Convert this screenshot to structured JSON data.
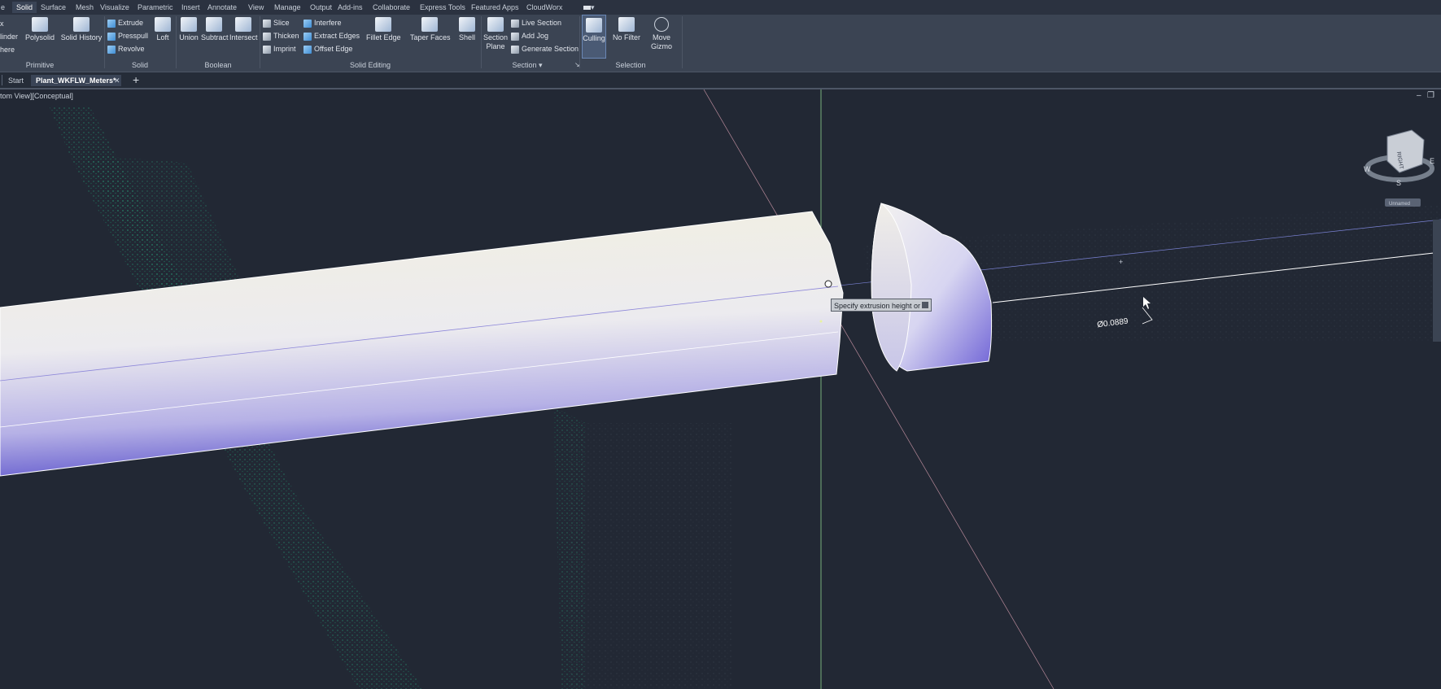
{
  "menu_tabs": [
    {
      "label": "Solid",
      "active": true
    },
    {
      "label": "Surface"
    },
    {
      "label": "Mesh"
    },
    {
      "label": "Visualize"
    },
    {
      "label": "Parametric"
    },
    {
      "label": "Insert"
    },
    {
      "label": "Annotate"
    },
    {
      "label": "View"
    },
    {
      "label": "Manage"
    },
    {
      "label": "Output"
    },
    {
      "label": "Add-ins"
    },
    {
      "label": "Collaborate"
    },
    {
      "label": "Express Tools"
    },
    {
      "label": "Featured Apps"
    },
    {
      "label": "CloudWorx"
    }
  ],
  "ribbon": {
    "primitive": {
      "title": "Primitive",
      "box_fragment": "x",
      "cylinder_fragment": "linder",
      "sphere_fragment": "here",
      "polysolid": "Polysolid"
    },
    "solid": {
      "title": "Solid",
      "solid_history": "Solid History",
      "extrude": "Extrude",
      "presspull": "Presspull",
      "revolve": "Revolve",
      "loft": "Loft"
    },
    "boolean": {
      "title": "Boolean",
      "union": "Union",
      "subtract": "Subtract",
      "intersect": "Intersect"
    },
    "solid_editing": {
      "title": "Solid Editing",
      "slice": "Slice",
      "thicken": "Thicken",
      "imprint": "Imprint",
      "interfere": "Interfere",
      "extract_edges": "Extract Edges",
      "offset_edge": "Offset Edge",
      "fillet_edge": "Fillet Edge",
      "taper_faces": "Taper Faces",
      "shell": "Shell"
    },
    "section": {
      "title": "Section",
      "section_plane_1": "Section",
      "section_plane_2": "Plane",
      "live_section": "Live Section",
      "add_jog": "Add Jog",
      "generate_section": "Generate Section"
    },
    "selection": {
      "title": "Selection",
      "culling": "Culling",
      "no_filter": "No Filter",
      "move_gizmo_1": "Move",
      "move_gizmo_2": "Gizmo"
    }
  },
  "doc_tabs": {
    "start": "Start",
    "active": "Plant_WKFLW_Meters*",
    "close": "✕",
    "new": "+"
  },
  "viewport": {
    "label": "tom View][Conceptual]",
    "tooltip": "Specify extrusion height or",
    "dimension": "Ø0.0889",
    "viewcube": {
      "face": "RIGHT",
      "east": "E",
      "west": "W",
      "south": "S",
      "ucs": "Unnamed"
    }
  },
  "colors": {
    "background": "#222834",
    "ribbon": "#3b4453",
    "accent": "#4a90d9",
    "cylinder_light": "#f3f1e4",
    "cylinder_dark": "#5148c8",
    "point_cloud": "#1fa37a"
  }
}
